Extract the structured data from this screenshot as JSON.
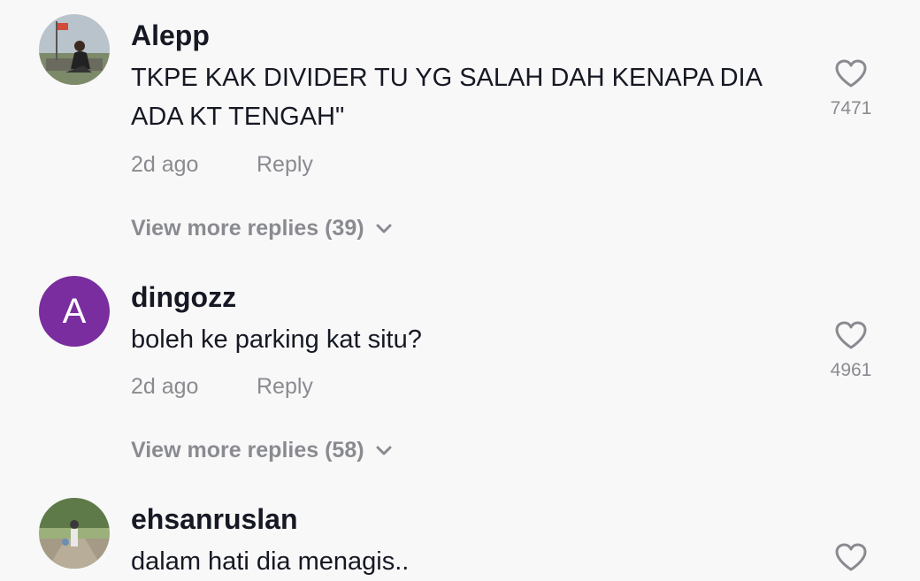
{
  "comments": [
    {
      "username": "Alepp",
      "text": "TKPE KAK DIVIDER TU YG SALAH DAH KENAPA DIA ADA KT TENGAH\"",
      "time": "2d ago",
      "reply_label": "Reply",
      "likes": "7471",
      "more_replies": "View more replies (39)",
      "avatar": "photo"
    },
    {
      "username": "dingozz",
      "text": "boleh ke parking kat situ?",
      "time": "2d ago",
      "reply_label": "Reply",
      "likes": "4961",
      "more_replies": "View more replies (58)",
      "avatar": "A",
      "avatar_color": "#7a2d9e"
    },
    {
      "username": "ehsanruslan",
      "text": "dalam hati dia menagis..",
      "avatar": "photo"
    }
  ],
  "icons": {
    "like": "heart-outline-icon",
    "expand": "chevron-down-icon"
  }
}
